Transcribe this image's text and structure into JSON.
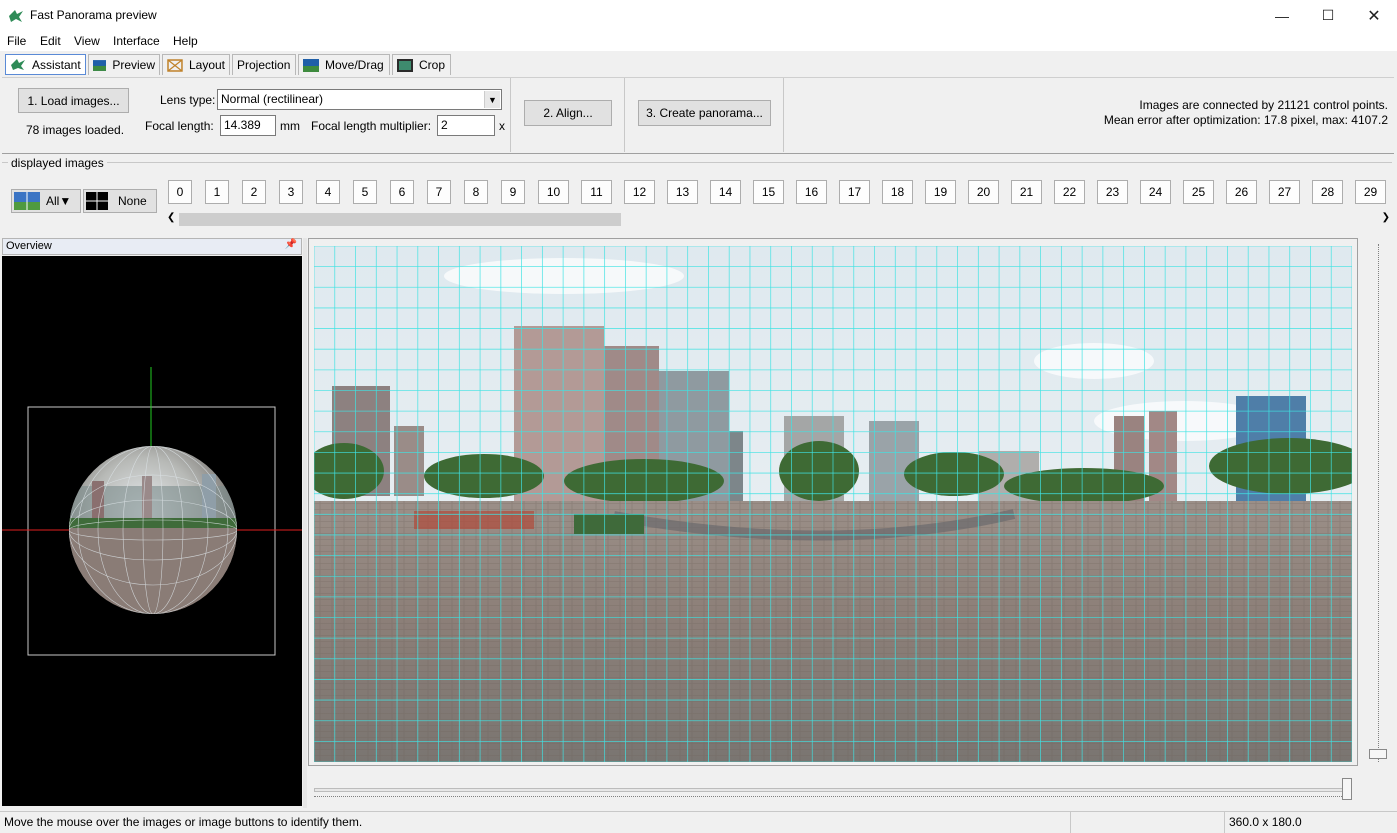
{
  "window": {
    "title": "Fast Panorama preview"
  },
  "menu": [
    "File",
    "Edit",
    "View",
    "Interface",
    "Help"
  ],
  "tabs": [
    "Assistant",
    "Preview",
    "Layout",
    "Projection",
    "Move/Drag",
    "Crop"
  ],
  "assistant": {
    "load_button": "1. Load images...",
    "loaded_text": "78 images loaded.",
    "lens_type_label": "Lens type:",
    "lens_type_value": "Normal (rectilinear)",
    "focal_length_label": "Focal length:",
    "focal_length_value": "14.389",
    "focal_length_unit": "mm",
    "multiplier_label": "Focal length multiplier:",
    "multiplier_value": "2",
    "multiplier_unit": "x",
    "align_button": "2. Align...",
    "create_button": "3. Create panorama...",
    "info_line1": "Images are connected by 21121 control points.",
    "info_line2": "Mean error after optimization: 17.8 pixel, max: 4107.2"
  },
  "displayed_images": {
    "group_label": "displayed images",
    "all_button": "All▼",
    "none_button": "None",
    "image_numbers": [
      "0",
      "1",
      "2",
      "3",
      "4",
      "5",
      "6",
      "7",
      "8",
      "9",
      "10",
      "11",
      "12",
      "13",
      "14",
      "15",
      "16",
      "17",
      "18",
      "19",
      "20",
      "21",
      "22",
      "23",
      "24",
      "25",
      "26",
      "27",
      "28",
      "29"
    ]
  },
  "overview": {
    "label": "Overview"
  },
  "status": {
    "message": "Move the mouse over the images or image buttons to identify them.",
    "fov": "360.0 x 180.0"
  },
  "colors": {
    "grid": "#3fe3e3",
    "accent": "#5a8ad6"
  }
}
